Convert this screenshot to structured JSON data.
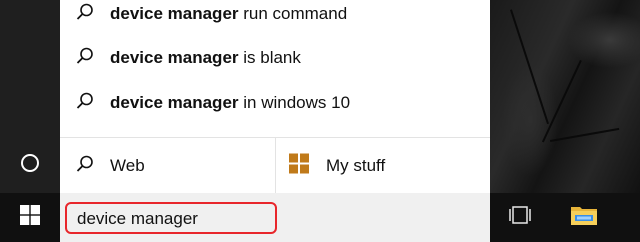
{
  "suggestions": [
    {
      "bold": "device manager",
      "rest": " run command"
    },
    {
      "bold": "device manager",
      "rest": " is blank"
    },
    {
      "bold": "device manager",
      "rest": " in windows 10"
    }
  ],
  "scopes": {
    "web_label": "Web",
    "stuff_label": "My stuff"
  },
  "taskbar": {
    "search_value": "device manager"
  },
  "icons": {
    "suggestion": "search-icon",
    "web": "search-icon",
    "stuff": "windows-logo-icon",
    "start": "windows-start-icon",
    "cortana": "cortana-ring-icon",
    "taskview": "task-view-icon",
    "explorer": "file-explorer-icon"
  },
  "colors": {
    "highlight_border": "#e8262b",
    "stuff_icon": "#c07a1a"
  }
}
